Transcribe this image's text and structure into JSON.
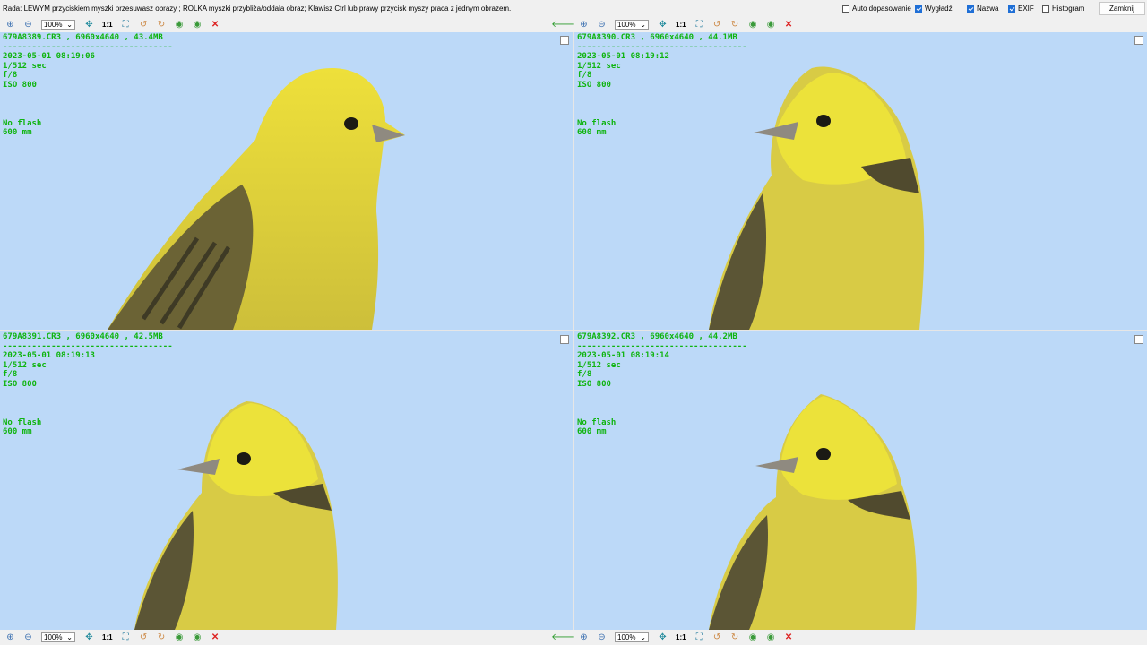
{
  "hint": "Rada: LEWYM przyciskiem myszki przesuwasz obrazy ; ROLKA myszki przybliża/oddala obraz; Klawisz Ctrl lub prawy przycisk myszy praca z jednym obrazem.",
  "options": [
    {
      "label": "Auto dopasowanie",
      "checked": false
    },
    {
      "label": "Wygładź",
      "checked": true
    },
    {
      "label": "Nazwa",
      "checked": true
    },
    {
      "label": "EXIF",
      "checked": true
    },
    {
      "label": "Histogram",
      "checked": false
    }
  ],
  "close_label": "Zamknij",
  "zoom_value": "100%",
  "one_to_one": "1:1",
  "colors": {
    "info_text": "#0fb40f",
    "sky": "#bcd9f8",
    "bird_yellow": "#e9e13a"
  },
  "icons": [
    "zoom-in-icon",
    "zoom-out-icon",
    "pan-icon",
    "fit-icon",
    "rotate-left-icon",
    "rotate-right-icon",
    "next-icon",
    "prev-icon",
    "close-icon",
    "arrow-left-icon"
  ],
  "panes": [
    {
      "name": "679A8389.CR3 , 6960x4640 , 43.4MB",
      "separator": "-----------------------------------",
      "datetime": "2023-05-01 08:19:06",
      "shutter": "1/512 sec",
      "aperture": "f/8",
      "iso": "ISO 800",
      "flash": "No flash",
      "focal": "600 mm"
    },
    {
      "name": "679A8390.CR3 , 6960x4640 , 44.1MB",
      "separator": "-----------------------------------",
      "datetime": "2023-05-01 08:19:12",
      "shutter": "1/512 sec",
      "aperture": "f/8",
      "iso": "ISO 800",
      "flash": "No flash",
      "focal": "600 mm"
    },
    {
      "name": "679A8391.CR3 , 6960x4640 , 42.5MB",
      "separator": "-----------------------------------",
      "datetime": "2023-05-01 08:19:13",
      "shutter": "1/512 sec",
      "aperture": "f/8",
      "iso": "ISO 800",
      "flash": "No flash",
      "focal": "600 mm"
    },
    {
      "name": "679A8392.CR3 , 6960x4640 , 44.2MB",
      "separator": "-----------------------------------",
      "datetime": "2023-05-01 08:19:14",
      "shutter": "1/512 sec",
      "aperture": "f/8",
      "iso": "ISO 800",
      "flash": "No flash",
      "focal": "600 mm"
    }
  ]
}
